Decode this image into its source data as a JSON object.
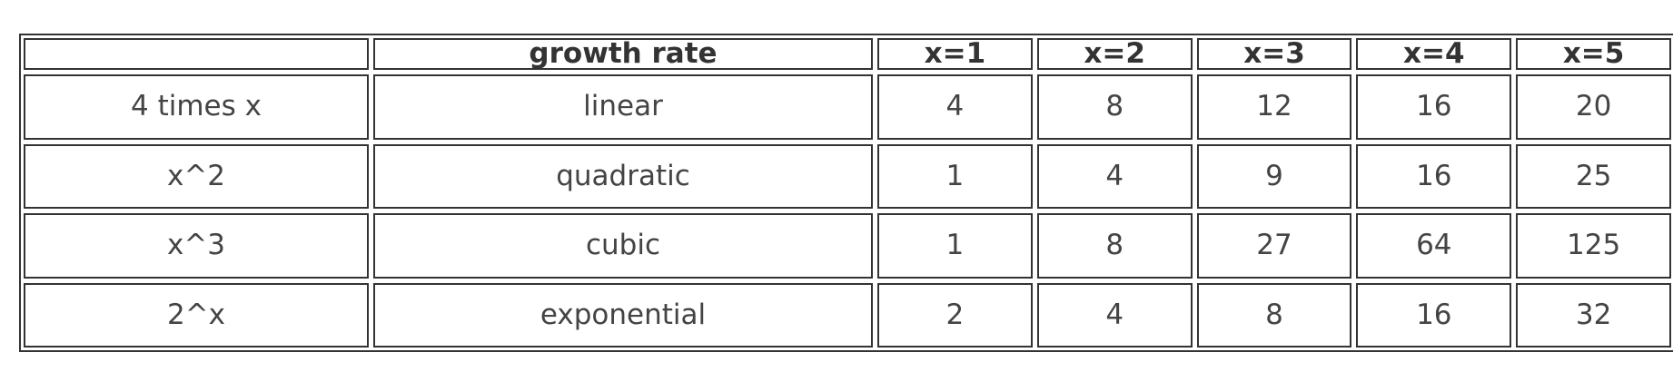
{
  "chart_data": {
    "type": "table",
    "columns": [
      "",
      "growth rate",
      "x=1",
      "x=2",
      "x=3",
      "x=4",
      "x=5"
    ],
    "rows": [
      [
        "4 times x",
        "linear",
        "4",
        "8",
        "12",
        "16",
        "20"
      ],
      [
        "x^2",
        "quadratic",
        "1",
        "4",
        "9",
        "16",
        "25"
      ],
      [
        "x^3",
        "cubic",
        "1",
        "8",
        "27",
        "64",
        "125"
      ],
      [
        "2^x",
        "exponential",
        "2",
        "4",
        "8",
        "16",
        "32"
      ]
    ]
  }
}
